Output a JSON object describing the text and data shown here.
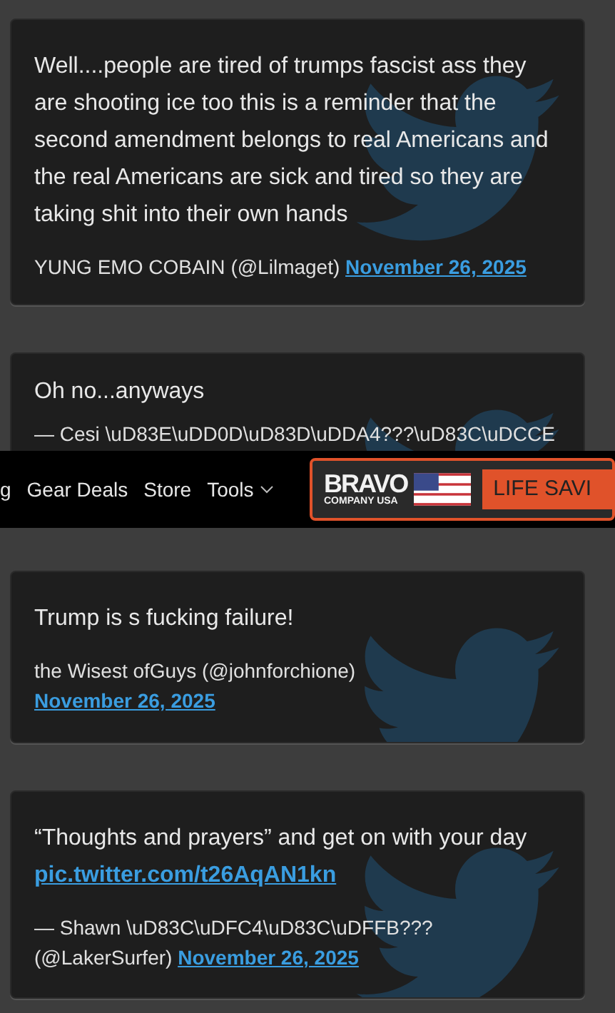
{
  "tweets": [
    {
      "text": "Well....people are tired of trumps fascist ass they are shooting ice too this is a reminder that the second amendment belongs to real Americans and the real Americans are sick and tired so they are taking shit into their own hands",
      "author": "YUNG EMO COBAIN",
      "handle": "(@Lilmaget)",
      "date": "November 26, 2025"
    },
    {
      "text": "Oh no...anyways",
      "author": "— Cesi \\uD83E\\uDD0D\\uD83D\\uDDA4???\\uD83C\\uDCCE"
    },
    {
      "text": "Trump is s fucking failure!",
      "author": "the Wisest ofGuys",
      "handle": "(@johnforchione)",
      "date": "November 26, 2025",
      "date_break": true
    },
    {
      "text": "“Thoughts and prayers” and get on with your day",
      "link": "pic.twitter.com/t26AqAN1kn",
      "author": "— Shawn \\uD83C\\uDFC4\\uD83C\\uDFFB???",
      "handle": "(@LakerSurfer)",
      "date": "November 26, 2025"
    }
  ],
  "nav": {
    "items": [
      {
        "label": "g",
        "kind": "link"
      },
      {
        "label": "Gear Deals",
        "kind": "link"
      },
      {
        "label": "Store",
        "kind": "link"
      },
      {
        "label": "Tools",
        "kind": "menu"
      }
    ],
    "ad": {
      "brand": "BRAVO",
      "sub": "COMPANY USA",
      "cta": "LIFE SAVI"
    }
  }
}
